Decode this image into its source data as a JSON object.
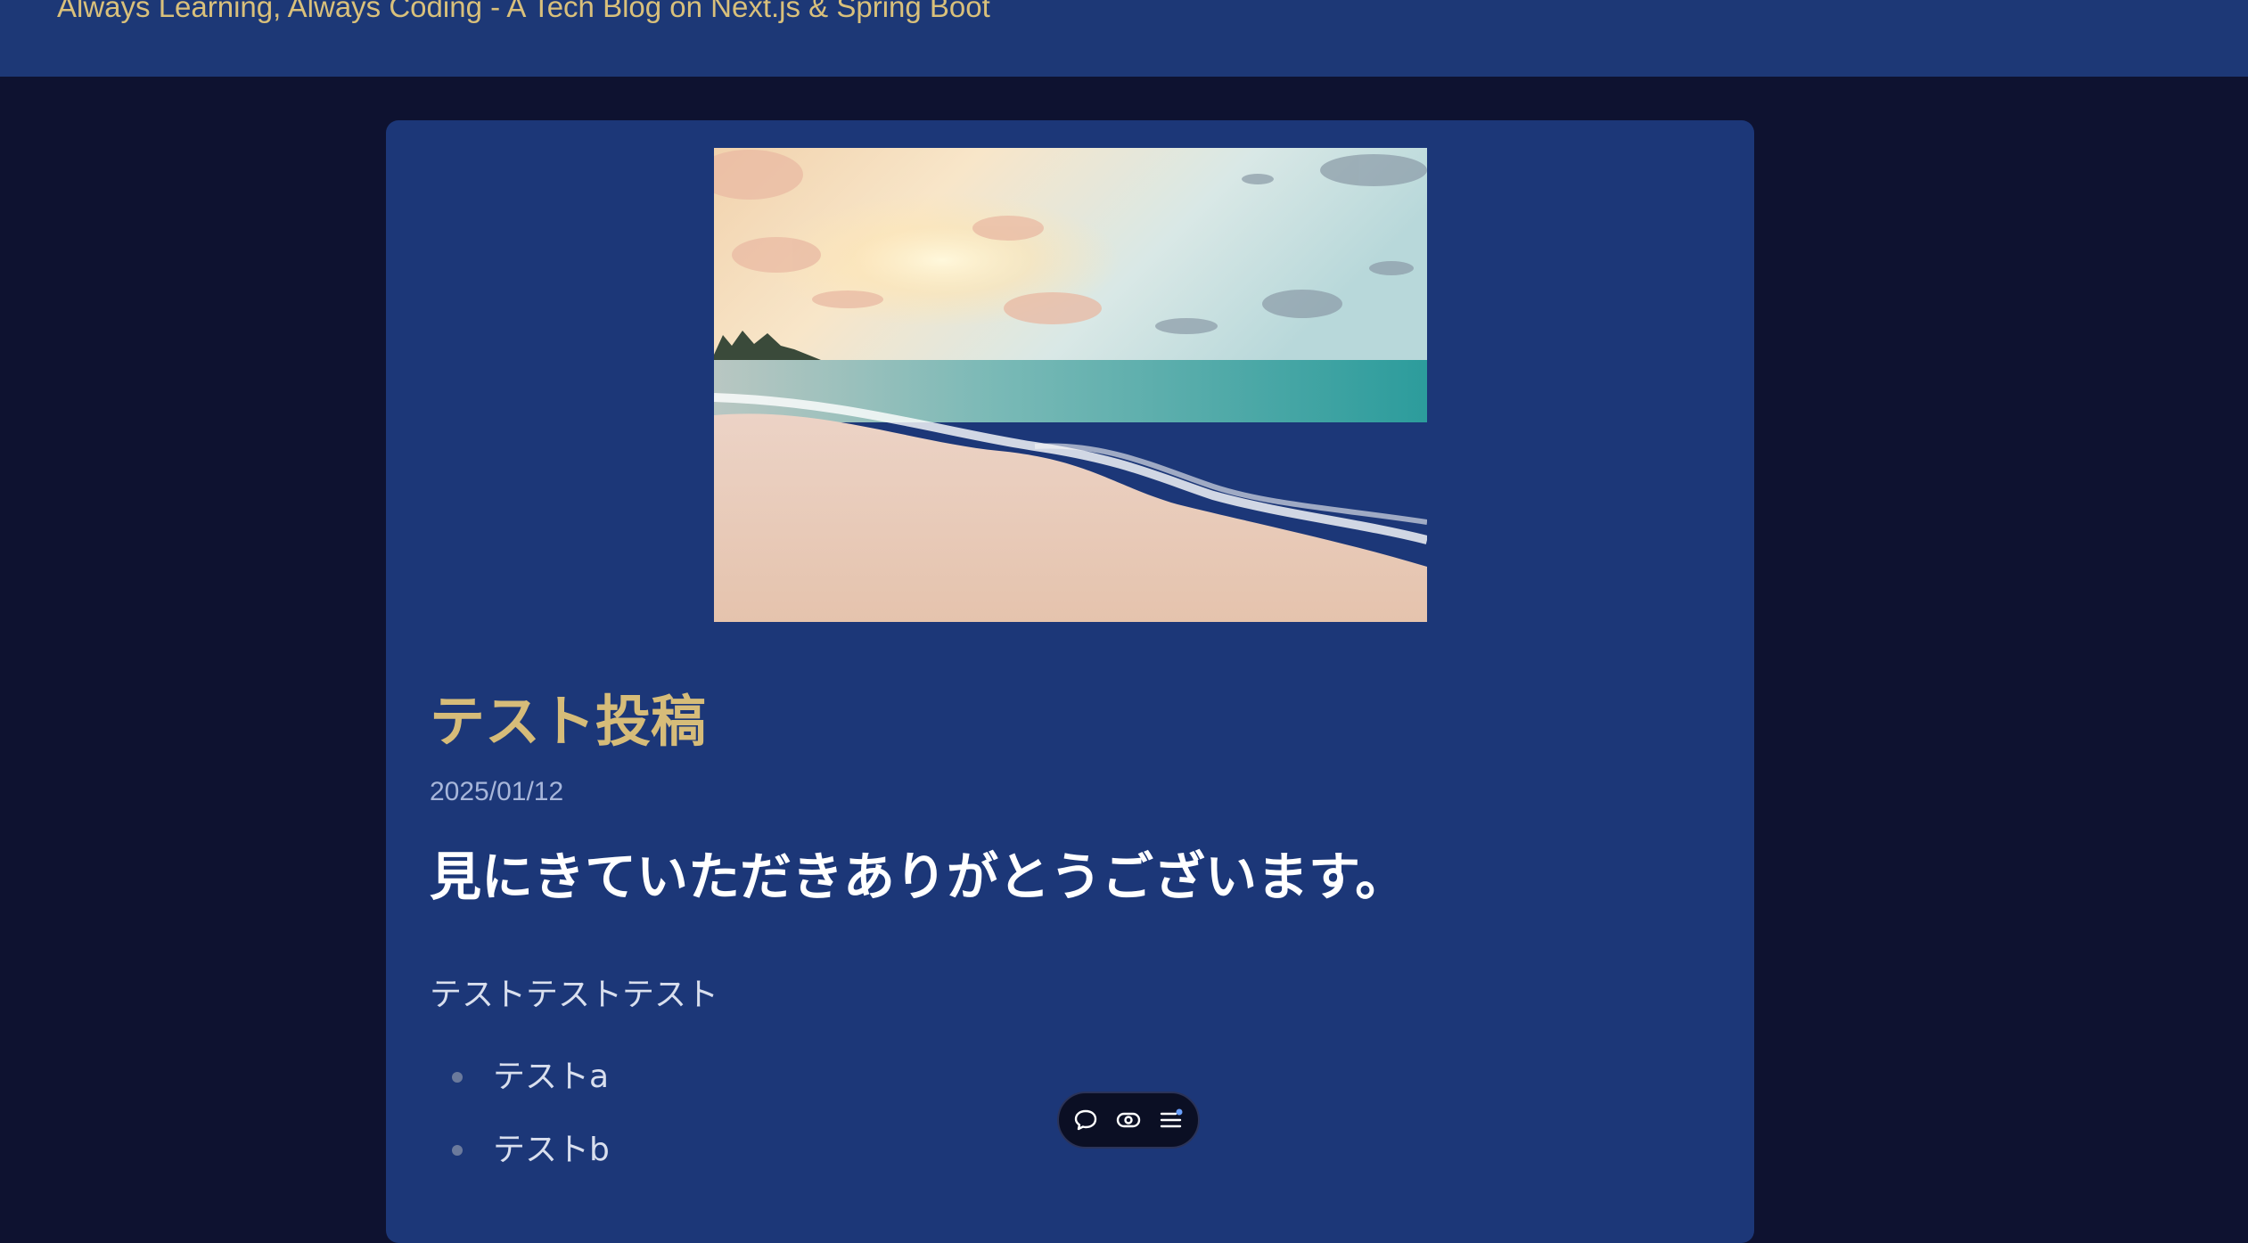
{
  "header": {
    "tagline": "Always Learning, Always Coding - A Tech Blog on Next.js & Spring Boot"
  },
  "post": {
    "title": "テスト投稿",
    "date": "2025/01/12",
    "heading": "見にきていただきありがとうございます。",
    "body": "テストテストテスト",
    "list": [
      "テストa",
      "テストb"
    ]
  },
  "toolbar": {
    "icons": [
      "comment-icon",
      "eye-icon",
      "menu-icon"
    ],
    "notification_dot_color": "#6aa0ff"
  },
  "colors": {
    "page_background": "#0e1230",
    "header_background": "#1d3876",
    "card_background": "#1c3778",
    "accent_gold": "#d6bc79"
  }
}
